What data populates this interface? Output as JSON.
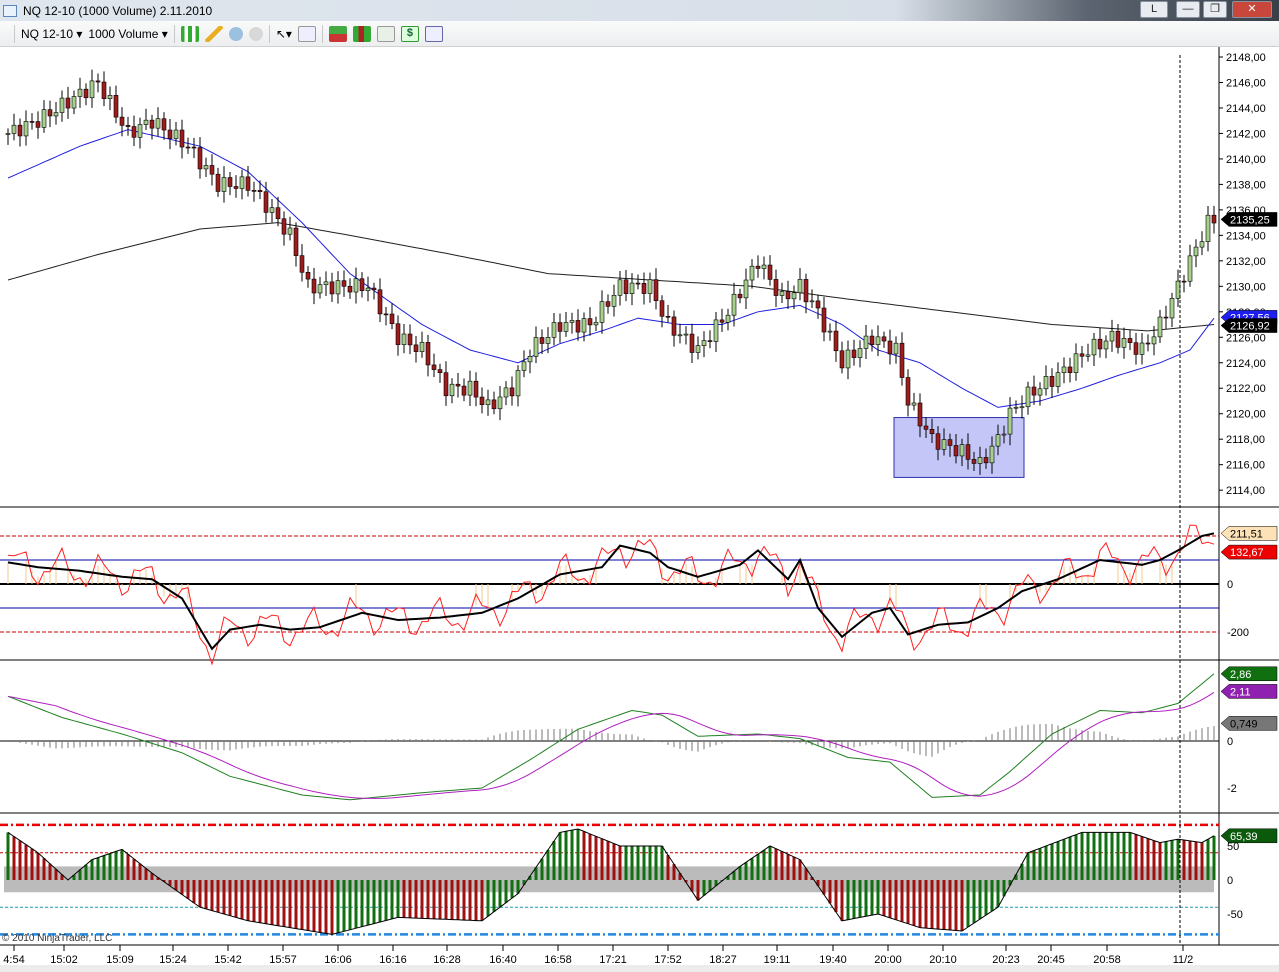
{
  "window": {
    "title": "NQ 12-10 (1000 Volume)  2.11.2010",
    "buttons": [
      "L",
      "—",
      "❐",
      "✕"
    ]
  },
  "toolbar": {
    "instrument": "NQ 12-10",
    "interval": "1000 Volume",
    "icons": [
      "bar-type-icon",
      "pencil-draw-icon",
      "zoom-in-icon",
      "zoom-out-icon",
      "pointer-icon",
      "search-icon",
      "strategy-icon",
      "candles-icon",
      "indicators-icon",
      "dollar-icon",
      "properties-icon"
    ]
  },
  "copyright": "© 2010 NinjaTrader, LLC",
  "colors": {
    "up": "#a6d08c",
    "down": "#9e1c1c",
    "ma_fast": "#2020e0",
    "ma_slow": "#202020",
    "cci_fast": "#ff2020",
    "macd": "#208020",
    "signal": "#b020c0",
    "hist_up": "#107010",
    "hist_down": "#a01010"
  },
  "chart_data": [
    {
      "type": "candlestick",
      "title": "NQ 12-10 (1000 Volume)",
      "ylim": [
        2113,
        2149
      ],
      "yticks": [
        "2148,00",
        "2146,00",
        "2144,00",
        "2142,00",
        "2140,00",
        "2138,00",
        "2136,00",
        "2134,00",
        "2132,00",
        "2130,00",
        "2128,00",
        "2126,00",
        "2124,00",
        "2122,00",
        "2120,00",
        "2118,00",
        "2116,00",
        "2114,00"
      ],
      "price_path": [
        [
          0,
          2142
        ],
        [
          5,
          2143
        ],
        [
          15,
          2146
        ],
        [
          20,
          2142
        ],
        [
          24,
          2143
        ],
        [
          30,
          2141
        ],
        [
          35,
          2138
        ],
        [
          40,
          2138
        ],
        [
          42,
          2137
        ],
        [
          47,
          2134
        ],
        [
          50,
          2130
        ],
        [
          55,
          2130
        ],
        [
          60,
          2130
        ],
        [
          65,
          2126
        ],
        [
          69,
          2125
        ],
        [
          73,
          2122
        ],
        [
          77,
          2122
        ],
        [
          80,
          2120.5
        ],
        [
          84,
          2122
        ],
        [
          87,
          2125
        ],
        [
          92,
          2127
        ],
        [
          97,
          2127
        ],
        [
          102,
          2130
        ],
        [
          107,
          2130
        ],
        [
          110,
          2127
        ],
        [
          115,
          2125
        ],
        [
          120,
          2128
        ],
        [
          125,
          2132
        ],
        [
          129,
          2129
        ],
        [
          132,
          2130
        ],
        [
          135,
          2128
        ],
        [
          139,
          2124
        ],
        [
          144,
          2126
        ],
        [
          148,
          2125
        ],
        [
          150,
          2121
        ],
        [
          154,
          2118
        ],
        [
          159,
          2117
        ],
        [
          162,
          2116
        ],
        [
          165,
          2118
        ],
        [
          167,
          2120
        ],
        [
          170,
          2121.5
        ],
        [
          175,
          2123
        ],
        [
          180,
          2125
        ],
        [
          184,
          2126
        ],
        [
          189,
          2125
        ],
        [
          192,
          2127
        ],
        [
          195,
          2130
        ],
        [
          197,
          2132
        ],
        [
          200,
          2135
        ],
        [
          201,
          2135.25
        ]
      ],
      "ma_fast": [
        [
          0,
          2138.5
        ],
        [
          12,
          2141
        ],
        [
          20,
          2142.3
        ],
        [
          32,
          2141
        ],
        [
          40,
          2139
        ],
        [
          49,
          2135
        ],
        [
          57,
          2131
        ],
        [
          69,
          2127
        ],
        [
          77,
          2125
        ],
        [
          85,
          2124
        ],
        [
          92,
          2125.5
        ],
        [
          99,
          2126.5
        ],
        [
          105,
          2127.5
        ],
        [
          112,
          2127
        ],
        [
          119,
          2127
        ],
        [
          125,
          2128
        ],
        [
          132,
          2128.5
        ],
        [
          139,
          2127
        ],
        [
          145,
          2125
        ],
        [
          152,
          2124
        ],
        [
          159,
          2122
        ],
        [
          165,
          2120.5
        ],
        [
          172,
          2121
        ],
        [
          179,
          2122
        ],
        [
          185,
          2123
        ],
        [
          192,
          2124
        ],
        [
          197,
          2125
        ],
        [
          201,
          2127.5
        ]
      ],
      "ma_slow": [
        [
          0,
          2130.5
        ],
        [
          15,
          2132.5
        ],
        [
          32,
          2134.5
        ],
        [
          45,
          2135
        ],
        [
          57,
          2134
        ],
        [
          74,
          2132.5
        ],
        [
          90,
          2131
        ],
        [
          107,
          2130.5
        ],
        [
          124,
          2130
        ],
        [
          140,
          2129
        ],
        [
          157,
          2128
        ],
        [
          174,
          2127
        ],
        [
          190,
          2126.5
        ],
        [
          201,
          2127
        ]
      ],
      "labels": {
        "last": "2135,25",
        "ma_fast": "2127,56",
        "ma_slow": "2126,92"
      },
      "highlight_box": {
        "from": 148,
        "to": 169,
        "low": 2115,
        "high": 2119.7
      }
    },
    {
      "type": "line",
      "name": "CCI",
      "ylim": [
        -310,
        310
      ],
      "yticks": [
        "0",
        "-200"
      ],
      "levels": [
        200,
        100,
        0,
        -100,
        -200
      ],
      "cci": [
        [
          0,
          90
        ],
        [
          5,
          70
        ],
        [
          12,
          55
        ],
        [
          19,
          30
        ],
        [
          24,
          20
        ],
        [
          29,
          -60
        ],
        [
          34,
          -270
        ],
        [
          37,
          -190
        ],
        [
          42,
          -170
        ],
        [
          47,
          -190
        ],
        [
          52,
          -180
        ],
        [
          59,
          -120
        ],
        [
          65,
          -150
        ],
        [
          72,
          -140
        ],
        [
          79,
          -120
        ],
        [
          85,
          -60
        ],
        [
          92,
          40
        ],
        [
          99,
          70
        ],
        [
          102,
          160
        ],
        [
          107,
          130
        ],
        [
          110,
          70
        ],
        [
          115,
          30
        ],
        [
          122,
          80
        ],
        [
          125,
          140
        ],
        [
          130,
          20
        ],
        [
          132,
          100
        ],
        [
          135,
          -100
        ],
        [
          139,
          -220
        ],
        [
          144,
          -120
        ],
        [
          147,
          -100
        ],
        [
          150,
          -210
        ],
        [
          155,
          -170
        ],
        [
          160,
          -160
        ],
        [
          165,
          -100
        ],
        [
          169,
          -30
        ],
        [
          175,
          20
        ],
        [
          182,
          100
        ],
        [
          189,
          80
        ],
        [
          192,
          100
        ],
        [
          195,
          140
        ],
        [
          199,
          200
        ],
        [
          201,
          211
        ]
      ],
      "labels": {
        "cci_slow": "211,51",
        "cci_fast": "132,67"
      }
    },
    {
      "type": "line",
      "name": "MACD",
      "ylim": [
        -3.2,
        3.2
      ],
      "yticks": [
        "0",
        "-2"
      ],
      "macd": [
        [
          0,
          1.9
        ],
        [
          9,
          1.0
        ],
        [
          19,
          0.3
        ],
        [
          29,
          -0.5
        ],
        [
          37,
          -1.5
        ],
        [
          49,
          -2.3
        ],
        [
          57,
          -2.5
        ],
        [
          69,
          -2.2
        ],
        [
          79,
          -2.0
        ],
        [
          87,
          -0.8
        ],
        [
          95,
          0.5
        ],
        [
          104,
          1.3
        ],
        [
          109,
          1.1
        ],
        [
          115,
          0.2
        ],
        [
          125,
          0.3
        ],
        [
          132,
          0.1
        ],
        [
          140,
          -0.7
        ],
        [
          147,
          -0.9
        ],
        [
          154,
          -2.4
        ],
        [
          162,
          -2.3
        ],
        [
          167,
          -1.3
        ],
        [
          174,
          0.3
        ],
        [
          182,
          1.3
        ],
        [
          189,
          1.2
        ],
        [
          195,
          1.6
        ],
        [
          201,
          2.86
        ]
      ],
      "labels": {
        "macd": "2,86",
        "signal": "2,11",
        "diff": "0,749"
      }
    },
    {
      "type": "bar",
      "name": "Oscillator",
      "ylim": [
        -95,
        95
      ],
      "yticks": [
        "50",
        "0",
        "-50"
      ],
      "osc": [
        [
          0,
          70
        ],
        [
          5,
          40
        ],
        [
          10,
          0
        ],
        [
          14,
          30
        ],
        [
          19,
          45
        ],
        [
          24,
          10
        ],
        [
          32,
          -40
        ],
        [
          40,
          -60
        ],
        [
          54,
          -80
        ],
        [
          65,
          -55
        ],
        [
          79,
          -60
        ],
        [
          85,
          -20
        ],
        [
          92,
          70
        ],
        [
          95,
          75
        ],
        [
          102,
          50
        ],
        [
          109,
          50
        ],
        [
          115,
          -30
        ],
        [
          122,
          20
        ],
        [
          127,
          50
        ],
        [
          132,
          30
        ],
        [
          139,
          -60
        ],
        [
          145,
          -50
        ],
        [
          152,
          -70
        ],
        [
          159,
          -75
        ],
        [
          165,
          -40
        ],
        [
          170,
          40
        ],
        [
          179,
          70
        ],
        [
          187,
          70
        ],
        [
          192,
          55
        ],
        [
          195,
          60
        ],
        [
          199,
          55
        ],
        [
          201,
          65
        ]
      ],
      "labels": {
        "value": "65,39"
      }
    }
  ],
  "time_axis": [
    "4:54",
    "15:02",
    "15:09",
    "15:24",
    "15:42",
    "15:57",
    "16:06",
    "16:16",
    "16:28",
    "16:40",
    "16:58",
    "17:21",
    "17:52",
    "18:27",
    "19:11",
    "19:40",
    "20:00",
    "20:10",
    "20:23",
    "20:45",
    "20:58",
    "11/2"
  ]
}
